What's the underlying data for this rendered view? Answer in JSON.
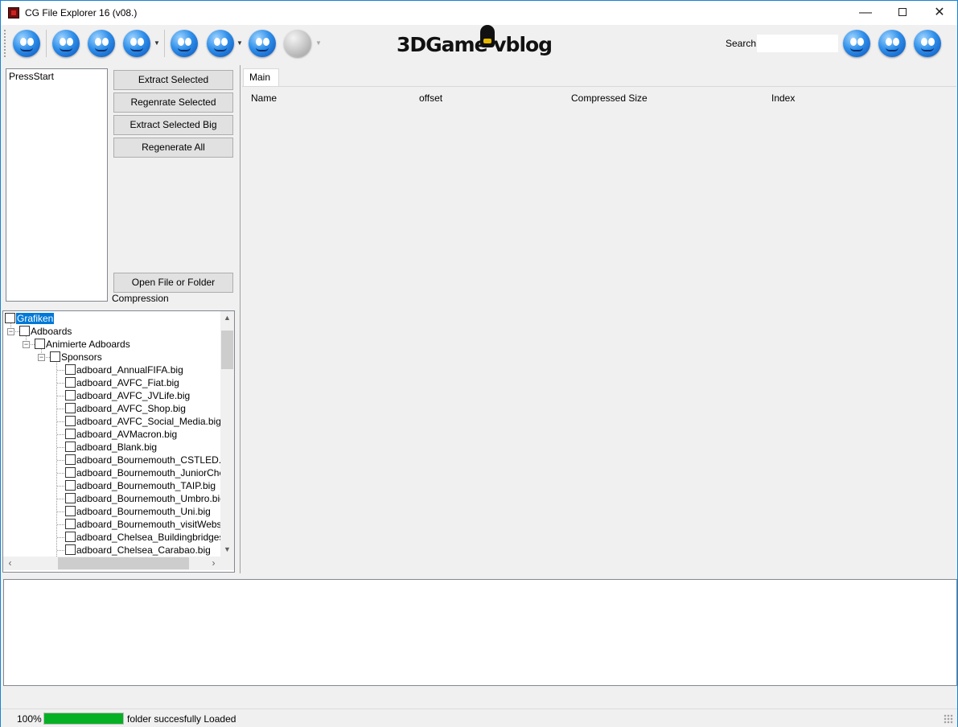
{
  "window": {
    "title": "CG File Explorer 16 (v08.)",
    "minimize_glyph": "—",
    "close_glyph": "✕"
  },
  "toolbar": {
    "icons": [
      "blue-smiley-icon",
      "roaring-smiley-icon",
      "worried-smiley-icon",
      "nervous-smiley-icon",
      "hands-smiley-icon",
      "winking-smiley-icon",
      "grimace-smiley-icon",
      "disabled-smiley-icon"
    ],
    "logo_text": "3DGame vblog",
    "search_label": "Search",
    "search_value": "",
    "right_icons": [
      "swirl-smiley-icon",
      "tongue-smiley-icon",
      "grinning-smiley-icon"
    ]
  },
  "file_list": {
    "items": [
      "PressStart"
    ]
  },
  "buttons": {
    "extract_selected": "Extract Selected",
    "regenerate_selected": "Regenrate Selected",
    "extract_selected_big": "Extract Selected Big",
    "regenerate_all": "Regenerate All",
    "open_file_or_folder": "Open File or Folder"
  },
  "compression_label": "Compression",
  "tree": {
    "root": "Grafiken",
    "level1": "Adboards",
    "level2": "Animierte Adboards",
    "level3": "Sponsors",
    "files": [
      "adboard_AnnualFIFA.big",
      "adboard_AVFC_Fiat.big",
      "adboard_AVFC_JVLife.big",
      "adboard_AVFC_Shop.big",
      "adboard_AVFC_Social_Media.big",
      "adboard_AVMacron.big",
      "adboard_Blank.big",
      "adboard_Bournemouth_CSTLED.big",
      "adboard_Bournemouth_JuniorCherries",
      "adboard_Bournemouth_TAIP.big",
      "adboard_Bournemouth_Umbro.big",
      "adboard_Bournemouth_Uni.big",
      "adboard_Bournemouth_visitWebsiteL",
      "adboard_Chelsea_Buildingbridges.big",
      "adboard_Chelsea_Carabao.big"
    ]
  },
  "tabs": {
    "main_label": "Main",
    "columns": [
      "Name",
      "offset",
      "Compressed Size",
      "Index"
    ]
  },
  "log": {
    "text": ""
  },
  "status": {
    "percent_text": "100%",
    "progress": 1.0,
    "message": "folder succesfully Loaded",
    "progress_color": "#06b025"
  }
}
